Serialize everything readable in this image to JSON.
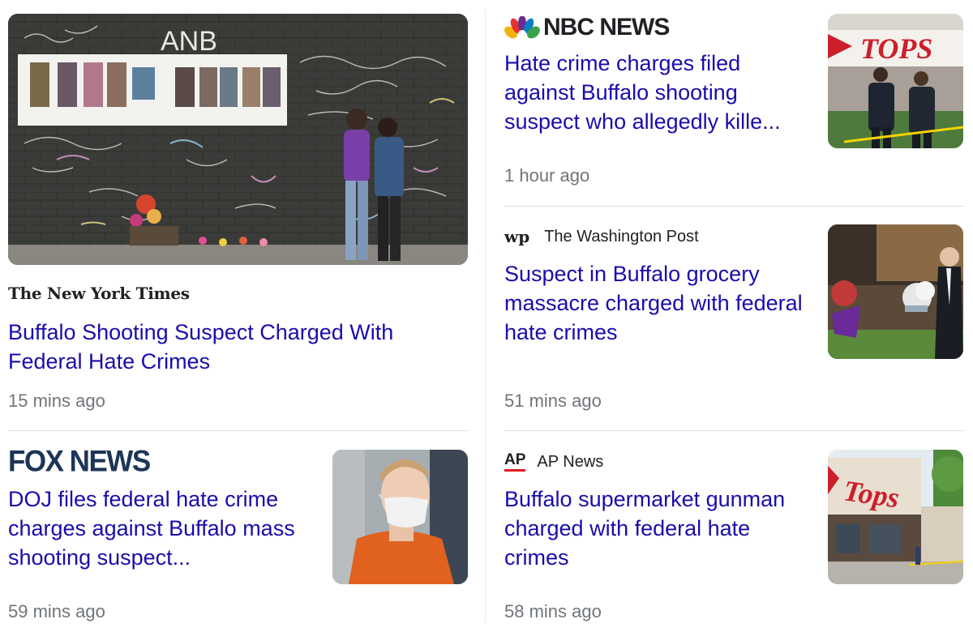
{
  "articles": [
    {
      "publisher": "The New York Times",
      "headline": "Buffalo Shooting Suspect Charged With Federal Hate Crimes",
      "time": "15 mins ago"
    },
    {
      "publisher": "NBC NEWS",
      "headline": "Hate crime charges filed against Buffalo shooting suspect who allegedly kille...",
      "time": "1 hour ago"
    },
    {
      "publisher": "The Washington Post",
      "publisher_mark": "wp",
      "headline": "Suspect in Buffalo grocery massacre charged with federal hate crimes",
      "time": "51 mins ago"
    },
    {
      "publisher": "FOX NEWS",
      "headline": "DOJ files federal hate crime charges against Buffalo mass shooting suspect...",
      "time": "59 mins ago"
    },
    {
      "publisher": "AP News",
      "publisher_mark": "AP",
      "headline": "Buffalo supermarket gunman charged with federal hate crimes",
      "time": "58 mins ago"
    }
  ],
  "thumbnails": {
    "memorial_wall_text": "ANB",
    "tops_sign_text": "TOPS",
    "tops_storefront_text": "Tops"
  },
  "colors": {
    "headline": "#1a0dab",
    "time": "#70757a",
    "divider": "#dadce0",
    "fox_navy": "#1d3557",
    "ap_red": "#e31b23"
  }
}
